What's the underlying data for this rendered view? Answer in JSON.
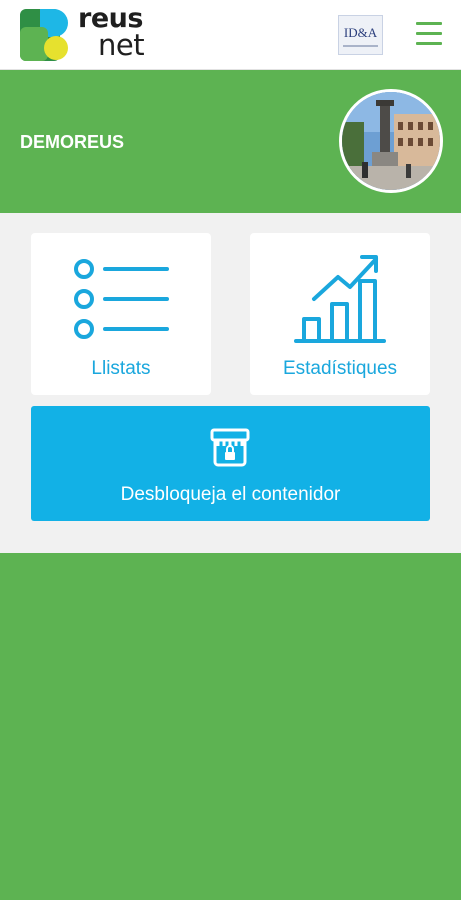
{
  "app": {
    "logo_line1": "reus",
    "logo_line2": "net",
    "partner_logo_text": "ID&A"
  },
  "profile": {
    "username": "DEMOREUS"
  },
  "actions": {
    "list_label": "Llistats",
    "stats_label": "Estadístiques",
    "unlock_label": "Desbloqueja el contenidor"
  },
  "colors": {
    "brand_green": "#5db352",
    "accent_blue": "#1aa7dd",
    "unlock_blue": "#12b1e6",
    "panel_bg": "#f1f1f1"
  },
  "icons": {
    "menu": "hamburger-icon",
    "list": "list-icon",
    "stats": "bar-chart-trend-icon",
    "unlock": "container-lock-icon"
  }
}
